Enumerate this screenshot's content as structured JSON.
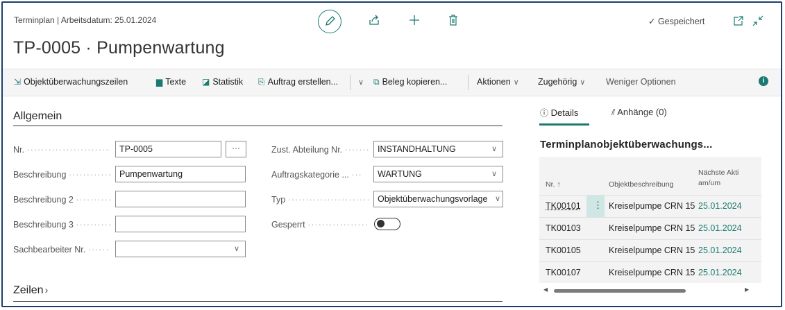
{
  "header": {
    "breadcrumb": "Terminplan | Arbeitsdatum: 25.01.2024",
    "title": "TP-0005 · Pumpenwartung",
    "saved_status": "✓ Gespeichert",
    "icons": [
      "pencil-icon",
      "share-icon",
      "plus-icon",
      "trash-icon",
      "popout-icon",
      "collapse-icon"
    ]
  },
  "actions": {
    "objektzeilen": "Objektüberwachungszeilen",
    "texte": "Texte",
    "statistik": "Statistik",
    "auftrag": "Auftrag erstellen...",
    "beleg": "Beleg kopieren...",
    "aktionen": "Aktionen",
    "zugehoerig": "Zugehörig",
    "weniger": "Weniger Optionen"
  },
  "general": {
    "section_title": "Allgemein",
    "nr_label": "Nr.",
    "nr_value": "TP-0005",
    "ellipsis": "···",
    "beschreibung_label": "Beschreibung",
    "beschreibung_value": "Pumpenwartung",
    "beschreibung2_label": "Beschreibung 2",
    "beschreibung2_value": "",
    "beschreibung3_label": "Beschreibung 3",
    "beschreibung3_value": "",
    "sachbearbeiter_label": "Sachbearbeiter Nr.",
    "sachbearbeiter_value": "",
    "abteilung_label": "Zust. Abteilung Nr.",
    "abteilung_value": "INSTANDHALTUNG",
    "auftragskat_label": "Auftragskategorie ...",
    "auftragskat_value": "WARTUNG",
    "typ_label": "Typ",
    "typ_value": "Objektüberwachungsvorlage",
    "gesperrt_label": "Gesperrt",
    "gesperrt_value": false
  },
  "lines": {
    "section_title": "Zeilen"
  },
  "factbox": {
    "tab_details": "Details",
    "tab_anhaenge": "Anhänge (0)",
    "part_title": "Terminplanobjektüberwachungs...",
    "col_nr": "Nr. ↑",
    "col_beschreibung": "Objektbeschreibung",
    "col_next_1": "Nächste Akti",
    "col_next_2": "am/um",
    "rows": [
      {
        "nr": "TK00101",
        "beschreibung": "Kreiselpumpe CRN 15",
        "datum": "25.01.2024"
      },
      {
        "nr": "TK00103",
        "beschreibung": "Kreiselpumpe CRN 15",
        "datum": "25.01.2024"
      },
      {
        "nr": "TK00105",
        "beschreibung": "Kreiselpumpe CRN 15",
        "datum": "25.01.2024"
      },
      {
        "nr": "TK00107",
        "beschreibung": "Kreiselpumpe CRN 15",
        "datum": "25.01.2024"
      }
    ]
  },
  "colors": {
    "accent": "#1a7a70",
    "border": "#1b3f6b",
    "selected_cell": "#cfe7e4"
  }
}
